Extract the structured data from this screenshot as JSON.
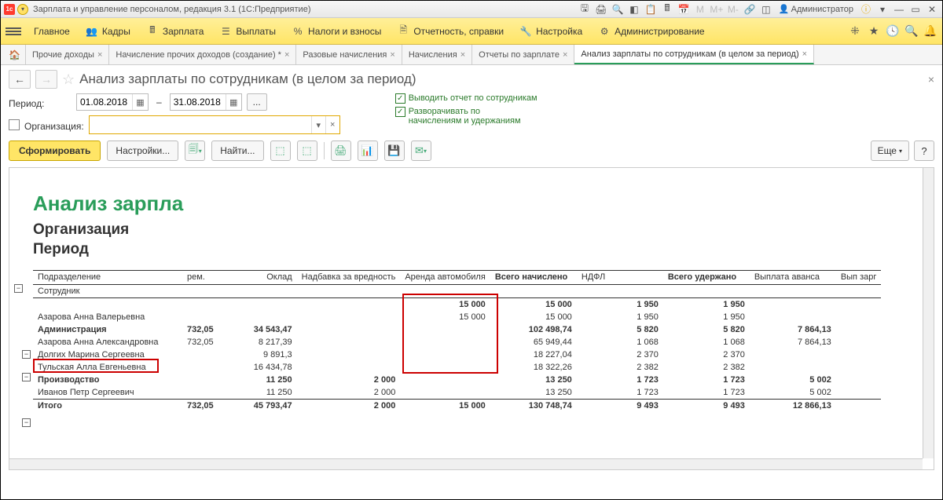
{
  "titlebar": {
    "title": "Зарплата и управление персоналом, редакция 3.1  (1С:Предприятие)",
    "user": "Администратор",
    "mem": {
      "m": "M",
      "mplus": "M+",
      "mminus": "M-"
    }
  },
  "menu": {
    "items": [
      {
        "label": "Главное"
      },
      {
        "label": "Кадры"
      },
      {
        "label": "Зарплата"
      },
      {
        "label": "Выплаты"
      },
      {
        "label": "Налоги и взносы"
      },
      {
        "label": "Отчетность, справки"
      },
      {
        "label": "Настройка"
      },
      {
        "label": "Администрирование"
      }
    ]
  },
  "tabs": [
    {
      "label": "Прочие доходы",
      "active": false
    },
    {
      "label": "Начисление прочих доходов (создание) *",
      "active": false
    },
    {
      "label": "Разовые начисления",
      "active": false
    },
    {
      "label": "Начисления",
      "active": false
    },
    {
      "label": "Отчеты по зарплате",
      "active": false
    },
    {
      "label": "Анализ зарплаты по сотрудникам (в целом за период)",
      "active": true
    }
  ],
  "page": {
    "title": "Анализ зарплаты по сотрудникам (в целом за период)",
    "period_label": "Период:",
    "org_label": "Организация:",
    "date_from": "01.08.2018",
    "date_to": "31.08.2018",
    "chk1": "Выводить отчет по сотрудникам",
    "chk2": "Разворачивать по начислениям и удержаниям",
    "btn_form": "Сформировать",
    "btn_settings": "Настройки...",
    "btn_find": "Найти...",
    "btn_more": "Еще"
  },
  "report": {
    "title": "Анализ зарпла",
    "sub1": "Организация",
    "sub2": "Период",
    "headers": {
      "c1": "Подразделение",
      "c1b": "Сотрудник",
      "c2": "рем.",
      "c3": "Оклад",
      "c4": "Надбавка за вредность",
      "c5": "Аренда автомобиля",
      "c6": "Всего начислено",
      "c7": "НДФЛ",
      "c8": "Всего удержано",
      "c9": "Выплата аванса",
      "c10": "Вып зарг"
    },
    "rows": [
      {
        "name": "",
        "prem": "",
        "oklad": "",
        "nadb": "",
        "arenda": "15 000",
        "vsego_n": "15 000",
        "ndfl": "1 950",
        "vsego_u": "1 950",
        "avans": "",
        "bold": true
      },
      {
        "name": "Азарова Анна Валерьевна",
        "prem": "",
        "oklad": "",
        "nadb": "",
        "arenda": "15 000",
        "vsego_n": "15 000",
        "ndfl": "1 950",
        "vsego_u": "1 950",
        "avans": "",
        "bold": false,
        "hl": true
      },
      {
        "name": "Администрация",
        "prem": "732,05",
        "oklad": "34 543,47",
        "nadb": "",
        "arenda": "",
        "vsego_n": "102 498,74",
        "ndfl": "5 820",
        "vsego_u": "5 820",
        "avans": "7 864,13",
        "bold": true
      },
      {
        "name": "Азарова Анна Александровна",
        "prem": "732,05",
        "oklad": "8 217,39",
        "nadb": "",
        "arenda": "",
        "vsego_n": "65 949,44",
        "ndfl": "1 068",
        "vsego_u": "1 068",
        "avans": "7 864,13",
        "bold": false
      },
      {
        "name": "Долгих Марина Сергеевна",
        "prem": "",
        "oklad": "9 891,3",
        "nadb": "",
        "arenda": "",
        "vsego_n": "18 227,04",
        "ndfl": "2 370",
        "vsego_u": "2 370",
        "avans": "",
        "bold": false
      },
      {
        "name": "Тульская Алла Евгеньевна",
        "prem": "",
        "oklad": "16 434,78",
        "nadb": "",
        "arenda": "",
        "vsego_n": "18 322,26",
        "ndfl": "2 382",
        "vsego_u": "2 382",
        "avans": "",
        "bold": false
      },
      {
        "name": "Производство",
        "prem": "",
        "oklad": "11 250",
        "nadb": "2 000",
        "arenda": "",
        "vsego_n": "13 250",
        "ndfl": "1 723",
        "vsego_u": "1 723",
        "avans": "5 002",
        "bold": true
      },
      {
        "name": "Иванов Петр Сергеевич",
        "prem": "",
        "oklad": "11 250",
        "nadb": "2 000",
        "arenda": "",
        "vsego_n": "13 250",
        "ndfl": "1 723",
        "vsego_u": "1 723",
        "avans": "5 002",
        "bold": false
      }
    ],
    "total": {
      "name": "Итого",
      "prem": "732,05",
      "oklad": "45 793,47",
      "nadb": "2 000",
      "arenda": "15 000",
      "vsego_n": "130 748,74",
      "ndfl": "9 493",
      "vsego_u": "9 493",
      "avans": "12 866,13"
    }
  }
}
